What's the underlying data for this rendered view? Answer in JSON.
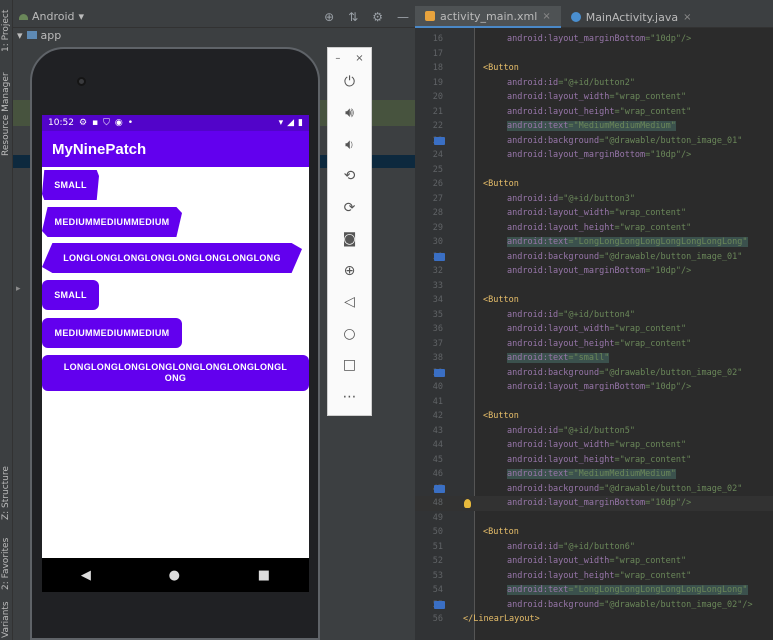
{
  "left_strip": {
    "project_tab": "1: Project",
    "resource_tab": "Resource Manager",
    "structure_tab": "Z: Structure",
    "favorites_tab": "2: Favorites",
    "variants_tab": "Variants"
  },
  "project_panel": {
    "view_selector": "Android",
    "root_item": "app"
  },
  "editor_tabs": [
    {
      "label": "activity_main.xml",
      "icon": "xml-file-icon",
      "active": true
    },
    {
      "label": "MainActivity.java",
      "icon": "java-file-icon",
      "active": false
    }
  ],
  "emulator_toolbar": {
    "buttons": [
      "power-icon",
      "volume-up-icon",
      "volume-down-icon",
      "rotate-left-icon",
      "rotate-right-icon",
      "camera-icon",
      "zoom-icon",
      "back-icon",
      "home-icon",
      "overview-icon",
      "more-icon"
    ],
    "minimize_glyph": "–",
    "close_glyph": "×"
  },
  "phone": {
    "status_time": "10:52",
    "app_title": "MyNinePatch",
    "buttons": [
      {
        "label": "SMALL",
        "style": "button_image_01"
      },
      {
        "label": "MEDIUMMEDIUMMEDIUM",
        "style": "button_image_01"
      },
      {
        "label": "LONGLONGLONGLONGLONGLONGLONGLONG",
        "style": "button_image_01"
      },
      {
        "label": "SMALL",
        "style": "button_image_02"
      },
      {
        "label": "MEDIUMMEDIUMMEDIUM",
        "style": "button_image_02"
      },
      {
        "label": "LONGLONGLONGLONGLONGLONGLONGLONGL ONG",
        "style": "button_image_02"
      }
    ]
  },
  "code_lines": [
    {
      "n": "16",
      "t": "android:layout_marginBottom=\"10dp\"/>"
    },
    {
      "n": "17",
      "t": ""
    },
    {
      "n": "18",
      "t": "<Button"
    },
    {
      "n": "19",
      "t": "android:id=\"@+id/button2\""
    },
    {
      "n": "20",
      "t": "android:layout_width=\"wrap_content\""
    },
    {
      "n": "21",
      "t": "android:layout_height=\"wrap_content\""
    },
    {
      "n": "22",
      "t": "android:text=\"MediumMediumMedium\""
    },
    {
      "n": "23",
      "t": "android:background=\"@drawable/button_image_01\""
    },
    {
      "n": "24",
      "t": "android:layout_marginBottom=\"10dp\"/>"
    },
    {
      "n": "25",
      "t": ""
    },
    {
      "n": "26",
      "t": "<Button"
    },
    {
      "n": "27",
      "t": "android:id=\"@+id/button3\""
    },
    {
      "n": "28",
      "t": "android:layout_width=\"wrap_content\""
    },
    {
      "n": "29",
      "t": "android:layout_height=\"wrap_content\""
    },
    {
      "n": "30",
      "t": "android:text=\"LongLongLongLongLongLongLongLong\""
    },
    {
      "n": "31",
      "t": "android:background=\"@drawable/button_image_01\""
    },
    {
      "n": "32",
      "t": "android:layout_marginBottom=\"10dp\"/>"
    },
    {
      "n": "33",
      "t": ""
    },
    {
      "n": "34",
      "t": "<Button"
    },
    {
      "n": "35",
      "t": "android:id=\"@+id/button4\""
    },
    {
      "n": "36",
      "t": "android:layout_width=\"wrap_content\""
    },
    {
      "n": "37",
      "t": "android:layout_height=\"wrap_content\""
    },
    {
      "n": "38",
      "t": "android:text=\"small\""
    },
    {
      "n": "39",
      "t": "android:background=\"@drawable/button_image_02\""
    },
    {
      "n": "40",
      "t": "android:layout_marginBottom=\"10dp\"/>"
    },
    {
      "n": "41",
      "t": ""
    },
    {
      "n": "42",
      "t": "<Button"
    },
    {
      "n": "43",
      "t": "android:id=\"@+id/button5\""
    },
    {
      "n": "44",
      "t": "android:layout_width=\"wrap_content\""
    },
    {
      "n": "45",
      "t": "android:layout_height=\"wrap_content\""
    },
    {
      "n": "46",
      "t": "android:text=\"MediumMediumMedium\""
    },
    {
      "n": "47",
      "t": "android:background=\"@drawable/button_image_02\""
    },
    {
      "n": "48",
      "t": "android:layout_marginBottom=\"10dp\"/>"
    },
    {
      "n": "49",
      "t": ""
    },
    {
      "n": "50",
      "t": "<Button"
    },
    {
      "n": "51",
      "t": "android:id=\"@+id/button6\""
    },
    {
      "n": "52",
      "t": "android:layout_width=\"wrap_content\""
    },
    {
      "n": "53",
      "t": "android:layout_height=\"wrap_content\""
    },
    {
      "n": "54",
      "t": "android:text=\"LongLongLongLongLongLongLongLong\""
    },
    {
      "n": "55",
      "t": "android:background=\"@drawable/button_image_02\"/>"
    },
    {
      "n": "56",
      "t": "</LinearLayout>"
    }
  ],
  "colors": {
    "app_primary": "#6200ee",
    "status_bar": "#5204c9",
    "ide_panel": "#3c3f41",
    "editor_bg": "#2b2b2b"
  }
}
